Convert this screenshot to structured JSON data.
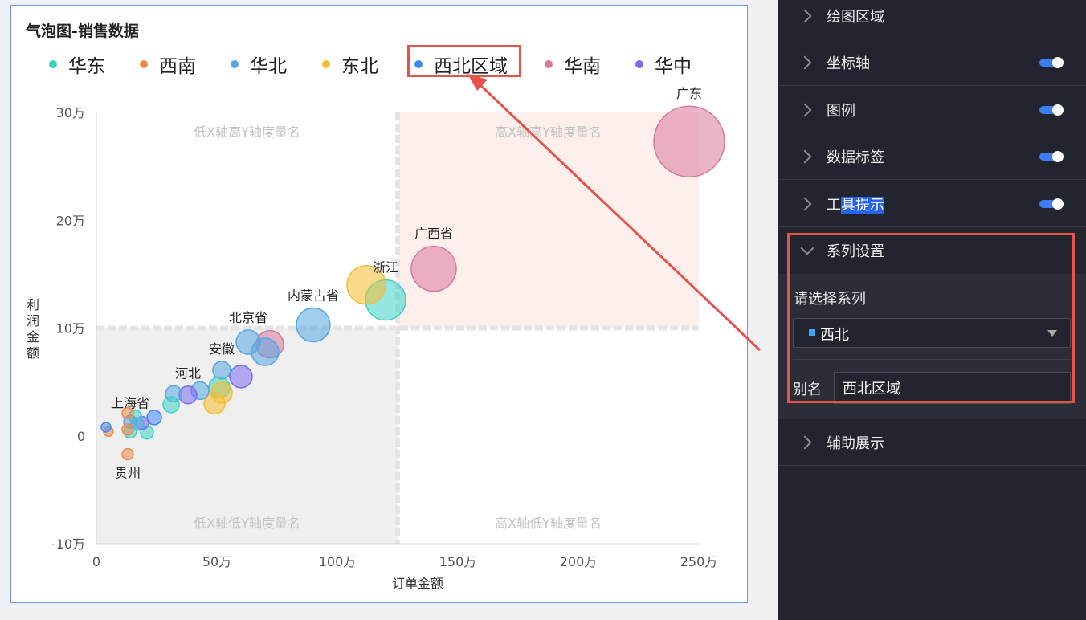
{
  "chart": {
    "title": "气泡图-销售数据",
    "legend": [
      {
        "name": "华东",
        "color": "#3fd1c7"
      },
      {
        "name": "西南",
        "color": "#f4884a"
      },
      {
        "name": "华北",
        "color": "#55a6e3"
      },
      {
        "name": "东北",
        "color": "#f6bd32"
      },
      {
        "name": "西北区域",
        "color": "#3d8af7"
      },
      {
        "name": "华南",
        "color": "#d8789b"
      },
      {
        "name": "华中",
        "color": "#7a6cf0"
      }
    ],
    "quadrants": {
      "top_left": "低X轴高Y轴度量名",
      "top_right": "高X轴高Y轴度量名",
      "bottom_left": "低X轴低Y轴度量名",
      "bottom_right": "高X轴低Y轴度量名"
    }
  },
  "chart_data": {
    "type": "scatter",
    "title": "气泡图-销售数据",
    "xlabel": "订单金额",
    "ylabel": "利润金额",
    "xlim": [
      0,
      2500000
    ],
    "ylim": [
      -100000,
      300000
    ],
    "x_ticks": [
      "0",
      "50万",
      "100万",
      "150万",
      "200万",
      "250万"
    ],
    "y_ticks": [
      "-10万",
      "0",
      "10万",
      "20万",
      "30万"
    ],
    "x_split": 1250000,
    "y_split": 100000,
    "points": [
      {
        "x": 2460000,
        "y": 273000,
        "r": 44,
        "color": "#d8789b",
        "label": "广东"
      },
      {
        "x": 1400000,
        "y": 155000,
        "r": 28,
        "color": "#d8789b",
        "label": "广西省"
      },
      {
        "x": 1200000,
        "y": 126000,
        "r": 25,
        "color": "#3fd1c7",
        "label": "浙江"
      },
      {
        "x": 1120000,
        "y": 140000,
        "r": 24,
        "color": "#f6bd32",
        "label": ""
      },
      {
        "x": 900000,
        "y": 103000,
        "r": 21,
        "color": "#55a6e3",
        "label": "内蒙古省"
      },
      {
        "x": 720000,
        "y": 85000,
        "r": 17,
        "color": "#d8789b",
        "label": ""
      },
      {
        "x": 700000,
        "y": 78000,
        "r": 17,
        "color": "#55a6e3",
        "label": ""
      },
      {
        "x": 630000,
        "y": 87000,
        "r": 15,
        "color": "#55a6e3",
        "label": "北京省"
      },
      {
        "x": 600000,
        "y": 55000,
        "r": 14,
        "color": "#7a6cf0",
        "label": ""
      },
      {
        "x": 520000,
        "y": 61000,
        "r": 11,
        "color": "#55a6e3",
        "label": "安徽"
      },
      {
        "x": 510000,
        "y": 45000,
        "r": 13,
        "color": "#3fd1c7",
        "label": ""
      },
      {
        "x": 520000,
        "y": 40000,
        "r": 13,
        "color": "#f6bd32",
        "label": ""
      },
      {
        "x": 490000,
        "y": 30000,
        "r": 13,
        "color": "#f6bd32",
        "label": ""
      },
      {
        "x": 430000,
        "y": 42000,
        "r": 11,
        "color": "#55a6e3",
        "label": ""
      },
      {
        "x": 380000,
        "y": 38000,
        "r": 11,
        "color": "#7a6cf0",
        "label": "河北"
      },
      {
        "x": 320000,
        "y": 39000,
        "r": 10,
        "color": "#55a6e3",
        "label": ""
      },
      {
        "x": 310000,
        "y": 29000,
        "r": 10,
        "color": "#3fd1c7",
        "label": ""
      },
      {
        "x": 240000,
        "y": 17000,
        "r": 9,
        "color": "#3d8af7",
        "label": ""
      },
      {
        "x": 210000,
        "y": 3000,
        "r": 8,
        "color": "#3fd1c7",
        "label": ""
      },
      {
        "x": 190000,
        "y": 12000,
        "r": 8,
        "color": "#7a6cf0",
        "label": ""
      },
      {
        "x": 170000,
        "y": 11000,
        "r": 8,
        "color": "#55a6e3",
        "label": ""
      },
      {
        "x": 160000,
        "y": 18000,
        "r": 8,
        "color": "#3fd1c7",
        "label": ""
      },
      {
        "x": 140000,
        "y": 4000,
        "r": 8,
        "color": "#3fd1c7",
        "label": ""
      },
      {
        "x": 140000,
        "y": 13000,
        "r": 8,
        "color": "#55a6e3",
        "label": "上海省"
      },
      {
        "x": 130000,
        "y": 21000,
        "r": 7,
        "color": "#f4884a",
        "label": ""
      },
      {
        "x": 130000,
        "y": 6000,
        "r": 7,
        "color": "#f4884a",
        "label": ""
      },
      {
        "x": 130000,
        "y": -17000,
        "r": 7,
        "color": "#f4884a",
        "label": "贵州"
      },
      {
        "x": 50000,
        "y": 4000,
        "r": 6,
        "color": "#f4884a",
        "label": ""
      },
      {
        "x": 40000,
        "y": 8000,
        "r": 6,
        "color": "#3d8af7",
        "label": ""
      }
    ]
  },
  "panel": {
    "rows": [
      {
        "label": "绘图区域",
        "toggle": false
      },
      {
        "label": "坐标轴",
        "toggle": true
      },
      {
        "label": "图例",
        "toggle": true
      },
      {
        "label": "数据标签",
        "toggle": true
      },
      {
        "label_a": "工",
        "label_b": "具提示",
        "toggle": true
      },
      {
        "label": "系列设置",
        "toggle": false
      },
      {
        "label": "辅助展示",
        "toggle": false
      }
    ],
    "series_prompt": "请选择系列",
    "series_selected": "西北",
    "alias_label": "别名",
    "alias_value": "西北区域"
  }
}
